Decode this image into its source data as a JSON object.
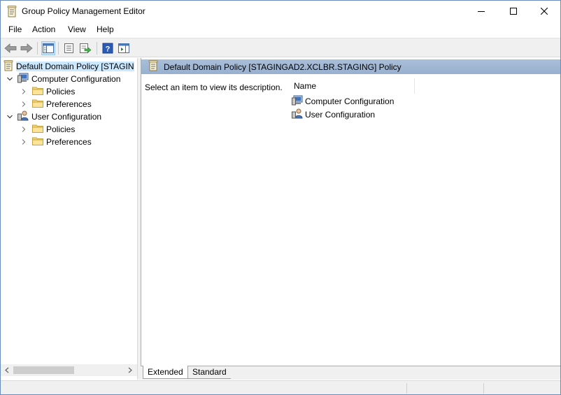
{
  "window": {
    "title": "Group Policy Management Editor",
    "title_icon": "policy-scroll-icon"
  },
  "menu": {
    "items": [
      {
        "label": "File"
      },
      {
        "label": "Action"
      },
      {
        "label": "View"
      },
      {
        "label": "Help"
      }
    ]
  },
  "toolbar": {
    "buttons": [
      {
        "icon": "back-arrow-icon"
      },
      {
        "icon": "forward-arrow-icon"
      },
      {
        "icon": "show-hide-console-tree-icon"
      },
      {
        "icon": "properties-icon"
      },
      {
        "icon": "export-list-icon"
      },
      {
        "icon": "help-icon"
      },
      {
        "icon": "show-action-pane-icon"
      }
    ]
  },
  "tree": {
    "root": {
      "label": "Default Domain Policy [STAGINGAD2.XCLBR.STAGING] Policy",
      "visible_label": "Default Domain Policy [STAGIN",
      "icon": "policy-scroll-icon"
    },
    "nodes": [
      {
        "label": "Computer Configuration",
        "icon": "computer-config-icon",
        "expanded": true,
        "children": [
          {
            "label": "Policies",
            "icon": "folder-icon"
          },
          {
            "label": "Preferences",
            "icon": "folder-icon"
          }
        ]
      },
      {
        "label": "User Configuration",
        "icon": "user-config-icon",
        "expanded": true,
        "children": [
          {
            "label": "Policies",
            "icon": "folder-icon"
          },
          {
            "label": "Preferences",
            "icon": "folder-icon"
          }
        ]
      }
    ]
  },
  "right_pane": {
    "header": "Default Domain Policy [STAGINGAD2.XCLBR.STAGING] Policy",
    "description": "Select an item to view its description.",
    "column_name": "Name",
    "items": [
      {
        "label": "Computer Configuration",
        "icon": "computer-config-icon"
      },
      {
        "label": "User Configuration",
        "icon": "user-config-icon"
      }
    ]
  },
  "tabs": [
    {
      "label": "Extended",
      "active": true
    },
    {
      "label": "Standard",
      "active": false
    }
  ],
  "colors": {
    "header_band": "#a9bed8",
    "selection": "#cce8ff",
    "chrome": "#f0f0f0"
  }
}
